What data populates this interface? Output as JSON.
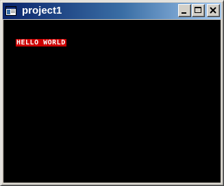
{
  "window": {
    "title": "project1",
    "icons": {
      "app": "app-window-icon",
      "minimize": "minimize-icon",
      "maximize": "maximize-icon",
      "close": "close-icon"
    }
  },
  "content": {
    "text": "HELLO WORLD",
    "text_color": "#ffffff",
    "highlight_color": "#cc0000",
    "background_color": "#000000"
  },
  "colors": {
    "titlebar_start": "#0a246a",
    "titlebar_end": "#a6caf0",
    "chrome": "#d4d0c8"
  }
}
